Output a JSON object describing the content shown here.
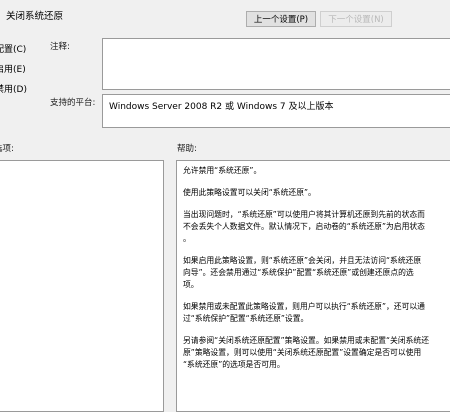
{
  "dialog": {
    "title": "关闭系统还原",
    "prev_button": "上一个设置(P)",
    "next_button": "下一个设置(N)"
  },
  "state": {
    "options": [
      {
        "label": "未配置(C)"
      },
      {
        "label": "已启用(E)"
      },
      {
        "label": "已禁用(D)"
      }
    ]
  },
  "comment": {
    "label": "注释:",
    "value": ""
  },
  "platform": {
    "label": "支持的平台:",
    "value": "Windows Server 2008 R2 或 Windows 7 及以上版本"
  },
  "options_section": {
    "label": "选项:"
  },
  "help": {
    "label": "帮助:",
    "paragraphs": [
      [
        "允许禁用“系统还原”。"
      ],
      [
        "使用此策略设置可以关闭“系统还原”。"
      ],
      [
        "当出现问题时，“系统还原”可以使用户将其计算机还原到先前的状态而",
        "不会丢失个人数据文件。默认情况下，启动卷的“系统还原”为启用状态",
        "。"
      ],
      [
        "如果启用此策略设置，则“系统还原”会关闭，并且无法访问“系统还原",
        "向导”。还会禁用通过“系统保护”配置“系统还原”或创建还原点的选",
        "项。"
      ],
      [
        "如果禁用或未配置此策略设置，则用户可以执行“系统还原”，还可以通",
        "过“系统保护”配置“系统还原”设置。"
      ],
      [
        "另请参阅“关闭系统还原配置”策略设置。如果禁用或未配置“关闭系统还",
        "原”策略设置，则可以使用“关闭系统还原配置”设置确定是否可以使用",
        "“系统还原”的选项是否可用。"
      ]
    ]
  }
}
